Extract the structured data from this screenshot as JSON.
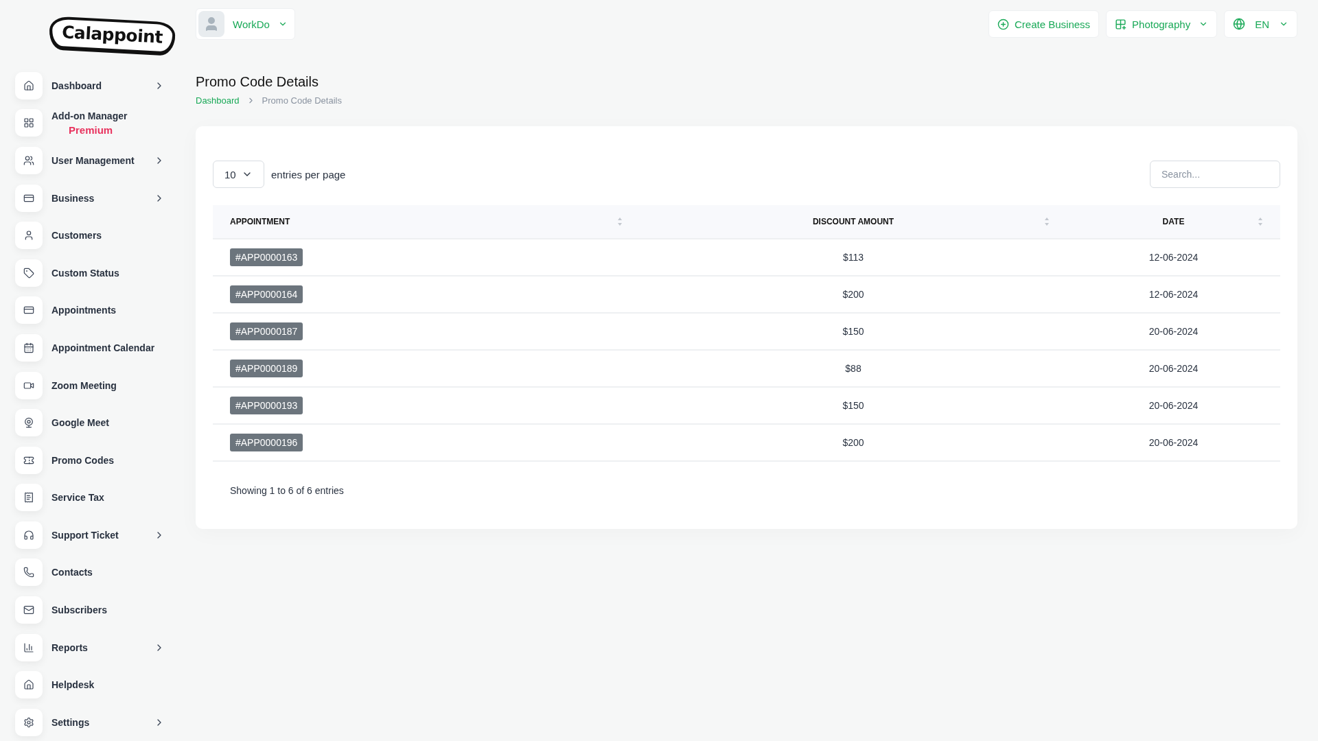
{
  "logo": {
    "text": "Calappoint"
  },
  "sidebar": {
    "items": [
      {
        "label": "Dashboard",
        "has_submenu": true
      },
      {
        "label": "Add-on Manager",
        "has_submenu": false,
        "badge": "Premium"
      },
      {
        "label": "User Management",
        "has_submenu": true
      },
      {
        "label": "Business",
        "has_submenu": true
      },
      {
        "label": "Customers",
        "has_submenu": false
      },
      {
        "label": "Custom Status",
        "has_submenu": false
      },
      {
        "label": "Appointments",
        "has_submenu": false
      },
      {
        "label": "Appointment Calendar",
        "has_submenu": false
      },
      {
        "label": "Zoom Meeting",
        "has_submenu": false
      },
      {
        "label": "Google Meet",
        "has_submenu": false
      },
      {
        "label": "Promo Codes",
        "has_submenu": false
      },
      {
        "label": "Service Tax",
        "has_submenu": false
      },
      {
        "label": "Support Ticket",
        "has_submenu": true
      },
      {
        "label": "Contacts",
        "has_submenu": false
      },
      {
        "label": "Subscribers",
        "has_submenu": false
      },
      {
        "label": "Reports",
        "has_submenu": true
      },
      {
        "label": "Helpdesk",
        "has_submenu": false
      },
      {
        "label": "Settings",
        "has_submenu": true
      }
    ]
  },
  "header": {
    "user": "WorkDo",
    "create_button": "Create Business",
    "business_select": "Photography",
    "language": "EN"
  },
  "page": {
    "title": "Promo Code Details",
    "breadcrumb": [
      "Dashboard",
      "Promo Code Details"
    ]
  },
  "table": {
    "page_size": "10",
    "page_size_label": "entries per page",
    "search": {
      "placeholder": "Search..."
    },
    "columns": [
      "APPOINTMENT",
      "DISCOUNT AMOUNT",
      "DATE"
    ],
    "rows": [
      {
        "appointment": "#APP0000163",
        "discount": "$113",
        "date": "12-06-2024"
      },
      {
        "appointment": "#APP0000164",
        "discount": "$200",
        "date": "12-06-2024"
      },
      {
        "appointment": "#APP0000187",
        "discount": "$150",
        "date": "20-06-2024"
      },
      {
        "appointment": "#APP0000189",
        "discount": "$88",
        "date": "20-06-2024"
      },
      {
        "appointment": "#APP0000193",
        "discount": "$150",
        "date": "20-06-2024"
      },
      {
        "appointment": "#APP0000196",
        "discount": "$200",
        "date": "20-06-2024"
      }
    ],
    "footer": "Showing 1 to 6 of 6 entries"
  }
}
